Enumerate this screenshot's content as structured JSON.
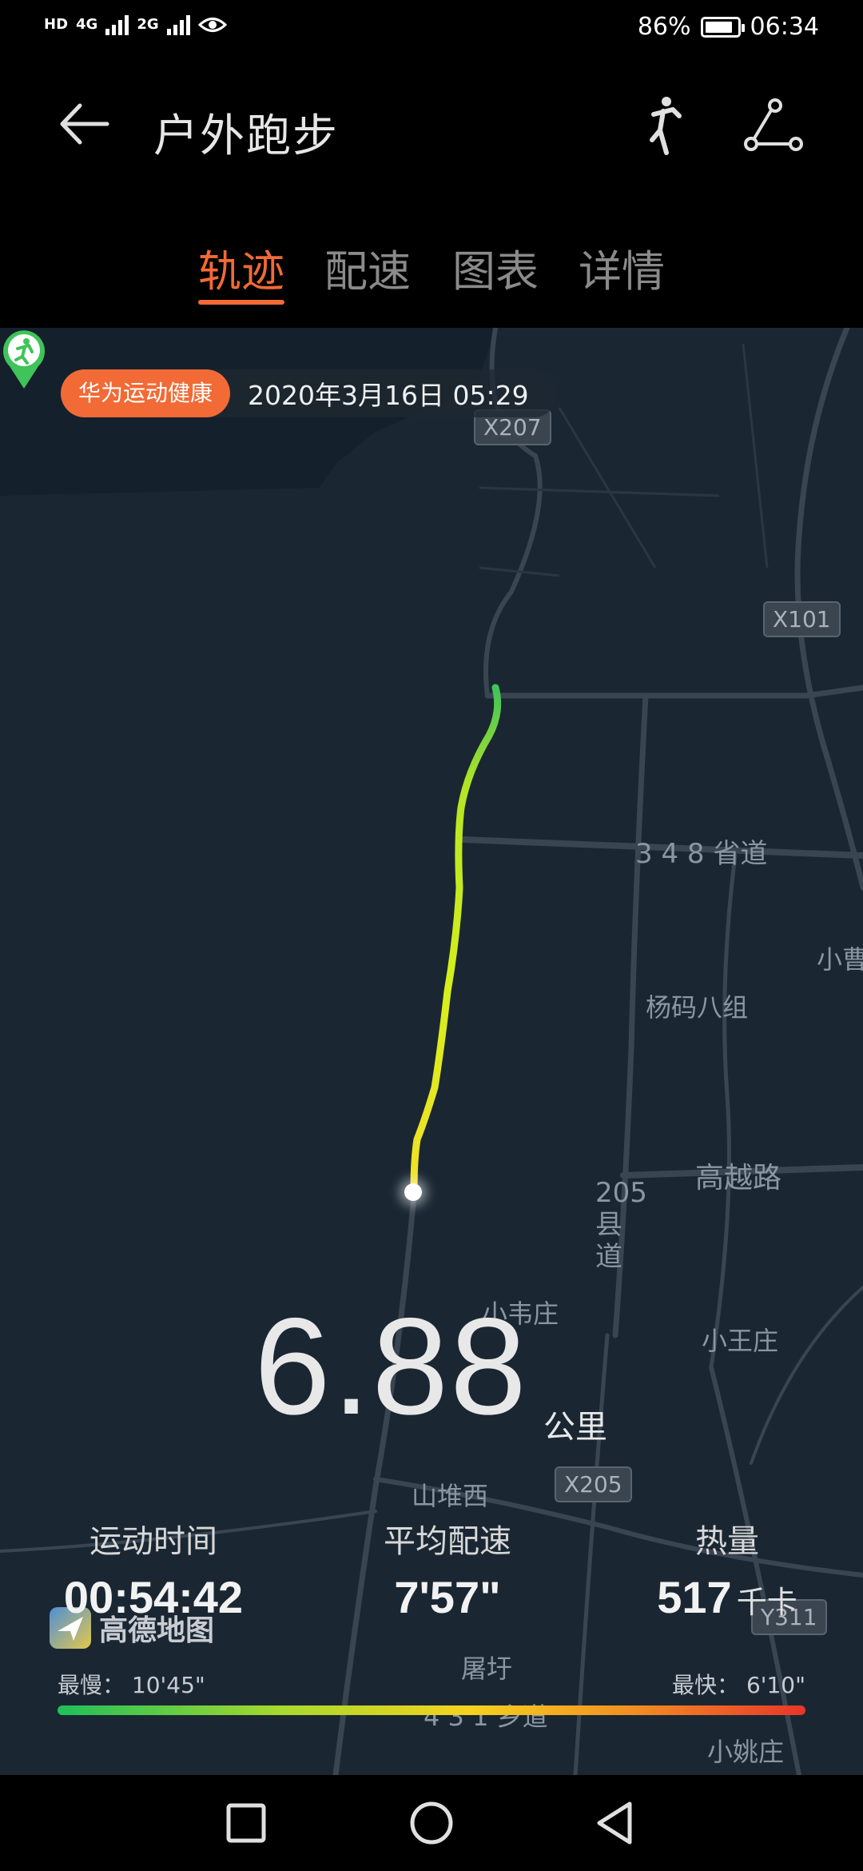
{
  "status_bar": {
    "network_left": "HD",
    "signal_1": "4G",
    "signal_2": "2G",
    "battery_percent": "86%",
    "battery_level": 0.86,
    "time": "06:34"
  },
  "app_bar": {
    "title": "户外跑步"
  },
  "tabs": [
    {
      "label": "轨迹",
      "active": true
    },
    {
      "label": "配速",
      "active": false
    },
    {
      "label": "图表",
      "active": false
    },
    {
      "label": "详情",
      "active": false
    }
  ],
  "map": {
    "source_badge": "华为运动健康",
    "date": "2020年3月16日 05:29",
    "labels": {
      "road_348": "3 4 8 省道",
      "yangma": "杨码八组",
      "xiaocao": "小曹",
      "gaoyue": "高越路",
      "county_205": "205县道",
      "xiaowei": "小韦庄",
      "xiaowang": "小王庄",
      "shandui": "山堆西",
      "tuyu": "屠圩",
      "road_431": "4 3 1 乡道",
      "xiaoyao": "小姚庄"
    },
    "shields": {
      "x207": "X207",
      "x101": "X101",
      "x205": "X205",
      "y311": "Y311"
    },
    "provider": "高德地图"
  },
  "summary": {
    "distance": "6.88",
    "distance_unit": "公里",
    "duration_label": "运动时间",
    "duration": "00:54:42",
    "pace_label": "平均配速",
    "pace": "7'57\"",
    "calories_label": "热量",
    "calories": "517",
    "calories_unit": "千卡",
    "slowest_label": "最慢：",
    "slowest": "10'45\"",
    "fastest_label": "最快：",
    "fastest": "6'10\""
  },
  "colors": {
    "accent": "#f26a35",
    "map_bg": "#1a2733",
    "route_start": "#3fc35a",
    "route_mid": "#d6ef1c",
    "route_end": "#f2df27"
  }
}
